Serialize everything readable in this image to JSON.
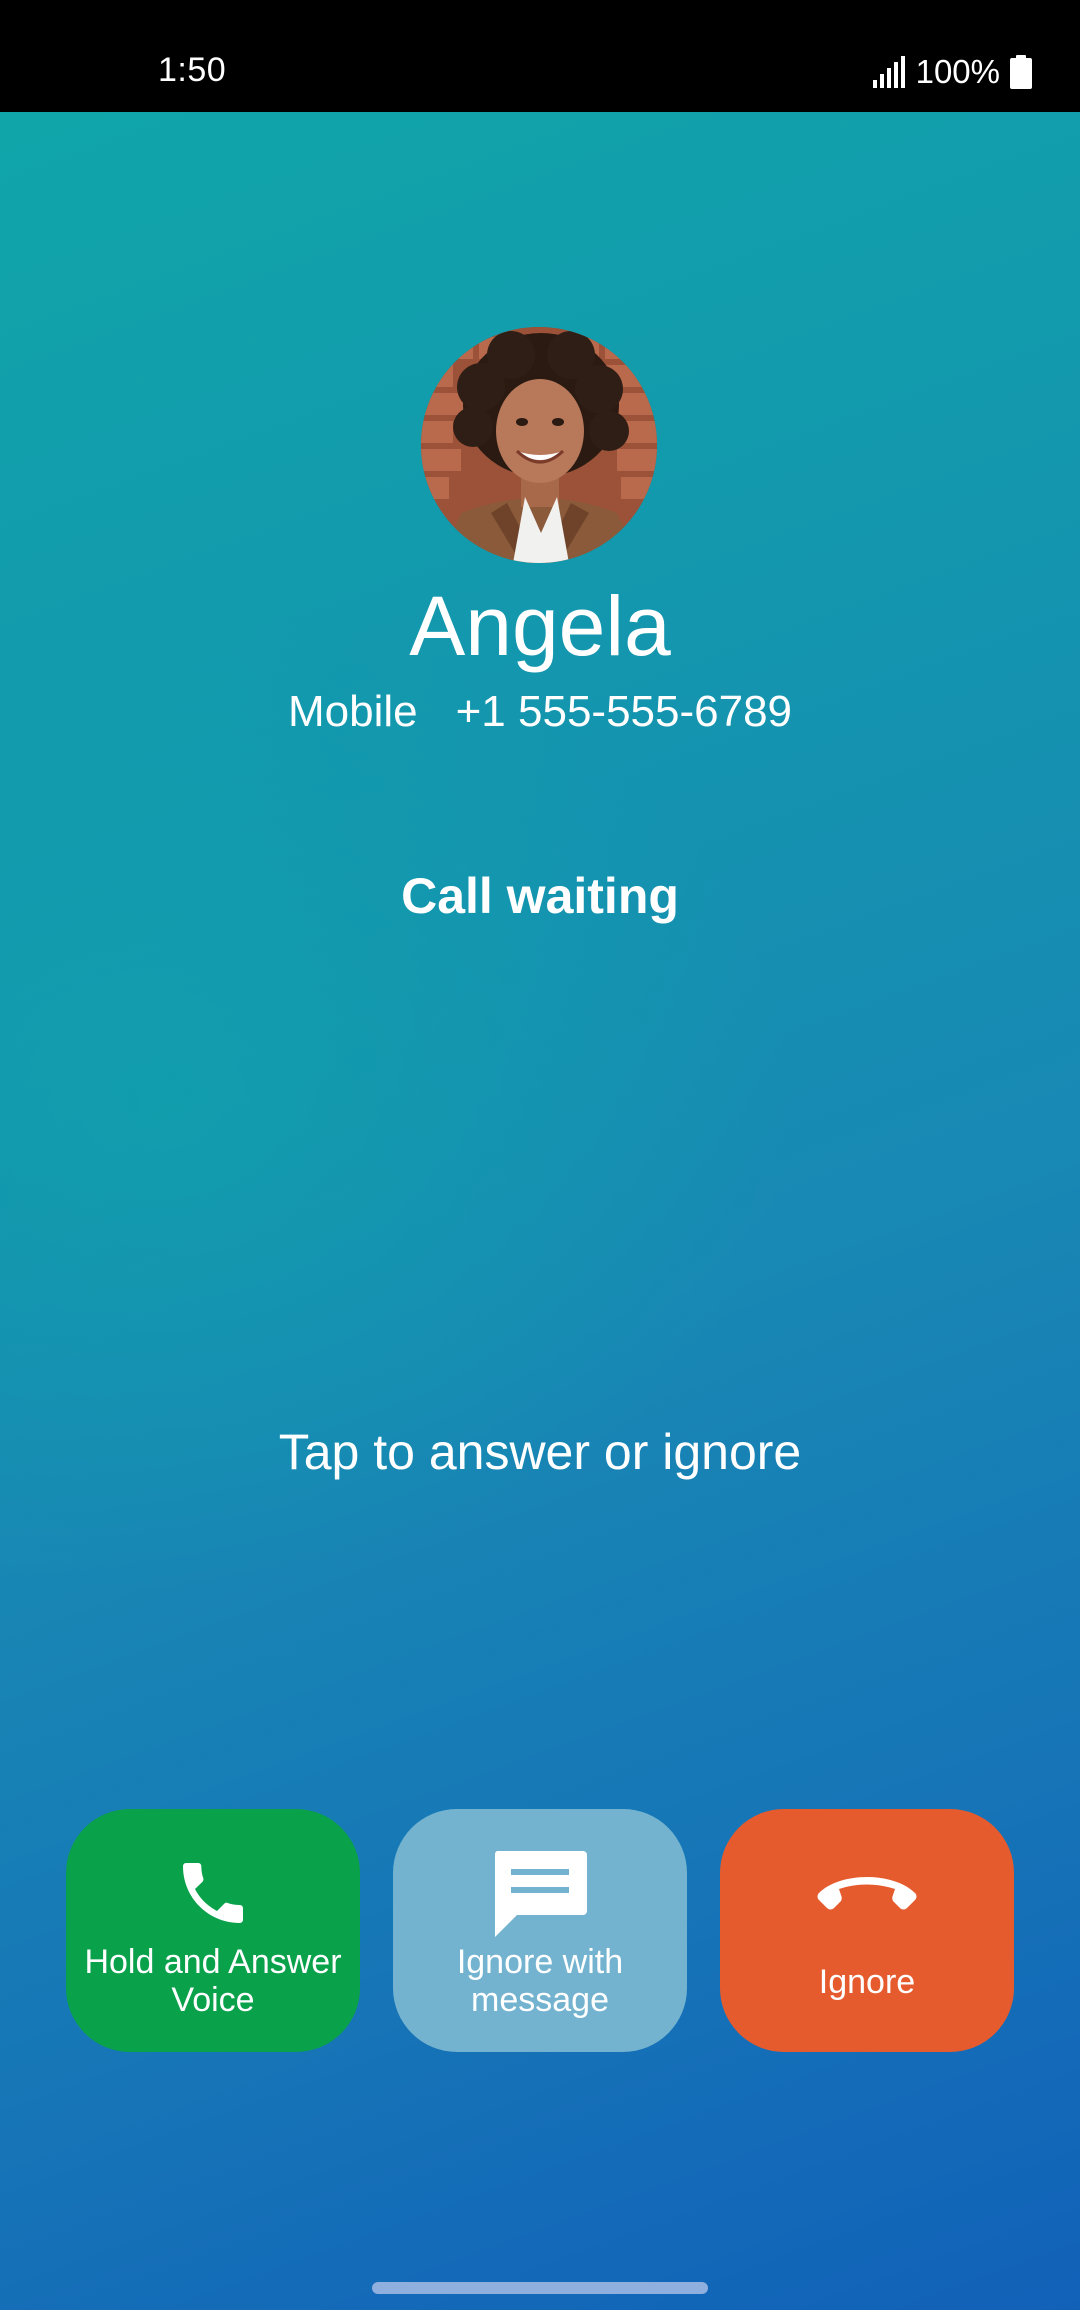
{
  "status_bar": {
    "time": "1:50",
    "battery": "100%",
    "icons": [
      "signal-icon",
      "battery-icon"
    ]
  },
  "caller": {
    "name": "Angela",
    "number_type": "Mobile",
    "number": "+1 555-555-6789"
  },
  "call_state": "Call waiting",
  "hint": "Tap to answer or ignore",
  "actions": {
    "hold_answer": {
      "line1": "Hold and Answer",
      "line2": "Voice",
      "icon": "phone-icon",
      "color": "#0aa14b"
    },
    "ignore_message": {
      "line1": "Ignore with",
      "line2": "message",
      "icon": "message-icon",
      "color": "#74b3cf"
    },
    "ignore": {
      "label": "Ignore",
      "icon": "hang-up-icon",
      "color": "#e65b2e"
    }
  }
}
